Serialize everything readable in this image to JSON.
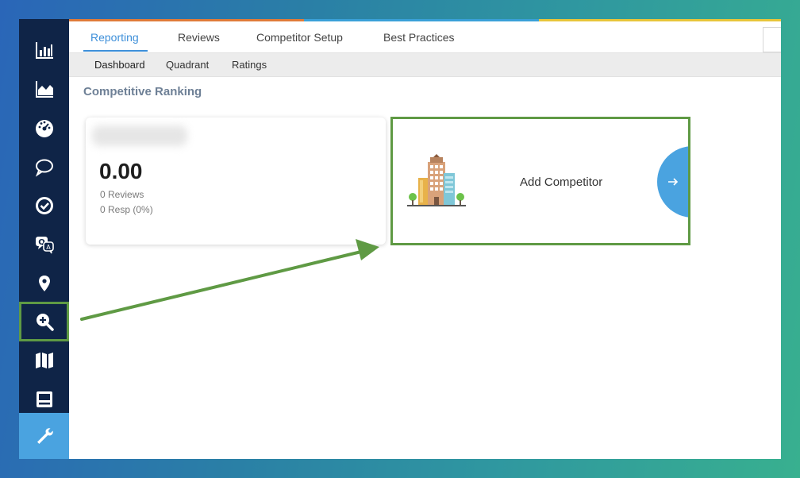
{
  "nav": {
    "tabs": [
      {
        "label": "Reporting",
        "active": true
      },
      {
        "label": "Reviews",
        "active": false
      },
      {
        "label": "Competitor Setup",
        "active": false
      },
      {
        "label": "Best Practices",
        "active": false
      }
    ],
    "subtabs": [
      {
        "label": "Dashboard",
        "active": true
      },
      {
        "label": "Quadrant",
        "active": false
      },
      {
        "label": "Ratings",
        "active": false
      }
    ]
  },
  "sidebar": {
    "items": [
      {
        "icon": "bar-chart-icon"
      },
      {
        "icon": "area-chart-icon"
      },
      {
        "icon": "dashboard-gauge-icon"
      },
      {
        "icon": "chat-bubble-icon"
      },
      {
        "icon": "check-circle-icon"
      },
      {
        "icon": "qa-icon"
      },
      {
        "icon": "location-pin-icon"
      },
      {
        "icon": "zoom-in-icon",
        "highlighted": true
      },
      {
        "icon": "map-icon"
      },
      {
        "icon": "window-panel-icon"
      },
      {
        "icon": "wrench-icon",
        "active": true
      }
    ]
  },
  "main": {
    "section_title": "Competitive Ranking",
    "business_card": {
      "score": "0.00",
      "reviews": "0 Reviews",
      "resp": "0 Resp (0%)"
    },
    "add_competitor": {
      "label": "Add Competitor",
      "button_icon": "arrow-right-icon"
    }
  },
  "annotations": {
    "highlight_color": "#5f9a44",
    "arrow": "arrow-from-zoom-icon-to-add-competitor"
  },
  "colors": {
    "sidebar_bg": "#0f2447",
    "accent_blue": "#4aa3e0",
    "active_tab": "#3d8fd9"
  }
}
